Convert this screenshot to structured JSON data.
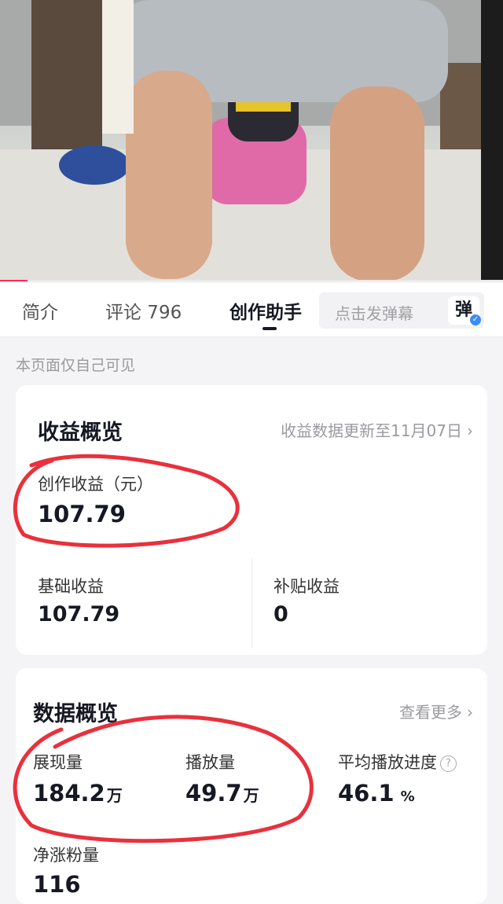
{
  "tabs": {
    "intro": "简介",
    "comments": "评论 796",
    "creator_assistant": "创作助手",
    "danmaku_placeholder": "点击发弹幕",
    "danmaku_button": "弹"
  },
  "video": {
    "progress_fraction": 0.055
  },
  "visibility_note": "本页面仅自己可见",
  "earnings": {
    "title": "收益概览",
    "update_link": "收益数据更新至11月07日",
    "creation_label": "创作收益（元）",
    "creation_value": "107.79",
    "basic_label": "基础收益",
    "basic_value": "107.79",
    "subsidy_label": "补贴收益",
    "subsidy_value": "0"
  },
  "data_overview": {
    "title": "数据概览",
    "more_link": "查看更多",
    "impressions_label": "展现量",
    "impressions_value": "184.2",
    "impressions_unit": "万",
    "plays_label": "播放量",
    "plays_value": "49.7",
    "plays_unit": "万",
    "avg_progress_label": "平均播放进度",
    "avg_progress_value": "46.1",
    "avg_progress_unit": "%",
    "net_followers_label": "净涨粉量",
    "net_followers_value": "116"
  },
  "colors": {
    "accent": "#fe2c55",
    "annotation": "#e8313c",
    "badge": "#3a8df7"
  }
}
